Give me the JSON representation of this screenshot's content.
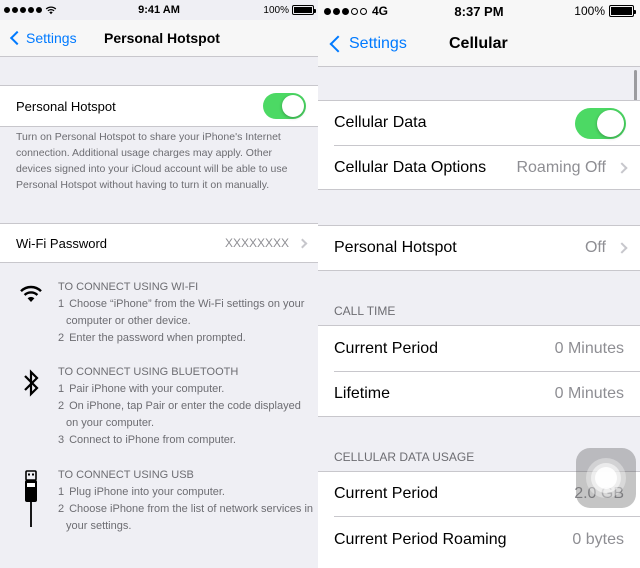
{
  "left": {
    "status": {
      "time": "9:41 AM",
      "battery_text": "100%",
      "signal_icon": "signal-dots-icon",
      "wifi_icon": "wifi-icon"
    },
    "nav": {
      "back_label": "Settings",
      "title": "Personal Hotspot"
    },
    "hotspot_row": {
      "label": "Personal Hotspot",
      "toggle_on": true
    },
    "hotspot_footer": "Turn on Personal Hotspot to share your iPhone's Internet connection. Additional usage charges may apply. Other devices signed into your iCloud account will be able to use Personal Hotspot without having to turn it on manually.",
    "wifi_password_row": {
      "label": "Wi-Fi Password",
      "value": "XXXXXXXX"
    },
    "instructions": [
      {
        "icon": "wifi-icon",
        "heading": "TO CONNECT USING WI-FI",
        "steps": [
          {
            "num": "1",
            "text": "Choose “iPhone” from the Wi-Fi settings on your computer or other device."
          },
          {
            "num": "2",
            "text": "Enter the password when prompted."
          }
        ]
      },
      {
        "icon": "bluetooth-icon",
        "heading": "TO CONNECT USING BLUETOOTH",
        "steps": [
          {
            "num": "1",
            "text": "Pair iPhone with your computer."
          },
          {
            "num": "2",
            "text": "On iPhone, tap Pair or enter the code displayed on your computer."
          },
          {
            "num": "3",
            "text": "Connect to iPhone from computer."
          }
        ]
      },
      {
        "icon": "usb-cable-icon",
        "heading": "TO CONNECT USING USB",
        "steps": [
          {
            "num": "1",
            "text": "Plug iPhone into your computer."
          },
          {
            "num": "2",
            "text": "Choose iPhone from the list of network services in your settings."
          }
        ]
      }
    ]
  },
  "right": {
    "status": {
      "carrier": "4G",
      "time": "8:37 PM",
      "battery_text": "100%",
      "signal_icon": "signal-dots-icon"
    },
    "nav": {
      "back_label": "Settings",
      "title": "Cellular"
    },
    "group1": [
      {
        "label": "Cellular Data",
        "toggle_on": true
      },
      {
        "label": "Cellular Data Options",
        "value": "Roaming Off"
      }
    ],
    "group2": [
      {
        "label": "Personal Hotspot",
        "value": "Off"
      }
    ],
    "call_time_header": "CALL TIME",
    "call_time": [
      {
        "label": "Current Period",
        "value": "0 Minutes"
      },
      {
        "label": "Lifetime",
        "value": "0 Minutes"
      }
    ],
    "usage_header": "CELLULAR DATA USAGE",
    "usage": [
      {
        "label": "Current Period",
        "value": "2.0 GB"
      },
      {
        "label": "Current Period Roaming",
        "value": "0 bytes"
      }
    ],
    "assistive_touch_icon": "assistive-touch-icon"
  },
  "colors": {
    "accent": "#007aff",
    "toggle_on": "#4cd964",
    "background": "#efeff4",
    "secondary_text": "#8e8e93",
    "footer_text": "#6d6d72"
  }
}
